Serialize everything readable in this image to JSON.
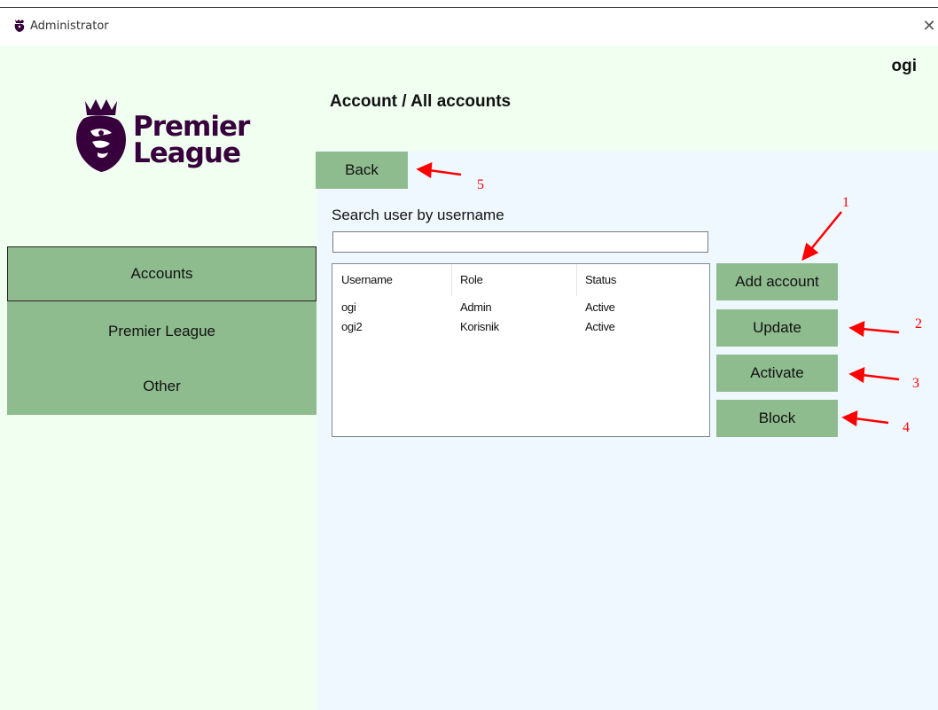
{
  "window": {
    "title": "Administrator",
    "close_glyph": "✕"
  },
  "header": {
    "user_name": "ogi",
    "page_title": "Account / All accounts",
    "logo_line1": "Premier",
    "logo_line2": "League",
    "logo_icon": "premier-league-lion-icon"
  },
  "sidebar": {
    "items": [
      {
        "label": "Accounts",
        "active": true
      },
      {
        "label": "Premier League",
        "active": false
      },
      {
        "label": "Other",
        "active": false
      }
    ]
  },
  "content": {
    "back_label": "Back",
    "search_label": "Search user by username",
    "search_value": "",
    "table": {
      "columns": [
        "Username",
        "Role",
        "Status"
      ],
      "rows": [
        [
          "ogi",
          "Admin",
          "Active"
        ],
        [
          "ogi2",
          "Korisnik",
          "Active"
        ]
      ]
    },
    "actions": {
      "add_account": "Add account",
      "update": "Update",
      "activate": "Activate",
      "block": "Block"
    }
  },
  "annotations": {
    "color": "#ff0000",
    "labels": [
      "1",
      "2",
      "3",
      "4",
      "5"
    ]
  },
  "colors": {
    "panel_bg": "#f0fff0",
    "content_bg": "#f0f8ff",
    "button_green": "#8fbc8f",
    "brand_purple": "#37003c"
  }
}
